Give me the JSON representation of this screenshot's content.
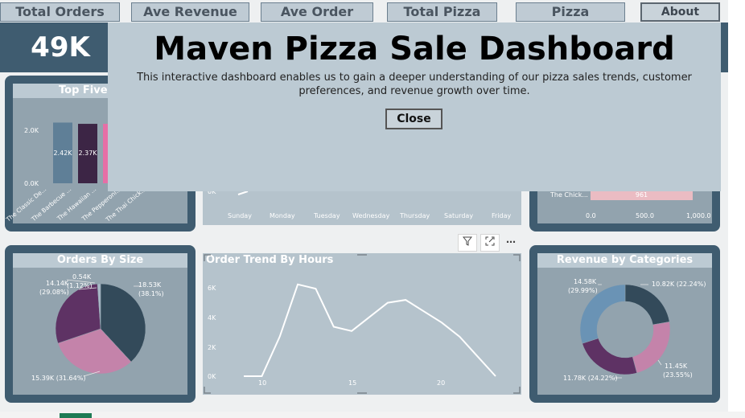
{
  "nav": {
    "total_orders": "Total Orders",
    "ave_revenue": "Ave Revenue",
    "ave_order_price": "Ave Order Price",
    "total_pizza_types": "Total Pizza Types",
    "pizza_categories": "Pizza Categories",
    "about": "About"
  },
  "kpi": {
    "total_orders_value": "49K"
  },
  "modal": {
    "title": "Maven Pizza Sale Dashboard",
    "description": "This interactive dashboard enables us to gain a deeper understanding of our pizza sales trends, customer preferences, and revenue growth over time.",
    "close_label": "Close"
  },
  "colors": {
    "header": "#3f5c70",
    "panel_fill": "#92a3ae",
    "title_bar": "#bccad3",
    "modal": "#bccad3"
  },
  "icons": {
    "filter": "filter-icon",
    "focus": "focus-mode-icon",
    "more": "more-options-icon"
  },
  "top5": {
    "title": "Top Five Pizza",
    "y_ticks": [
      "2.0K",
      "0.0K"
    ],
    "categories": [
      "The Classic De...",
      "The Barbecue ...",
      "The Hawaiian ...",
      "The Pepperoni...",
      "The Thai Chick..."
    ],
    "bar_labels": [
      "2.42K",
      "2.37K",
      "2"
    ]
  },
  "weekday": {
    "y_tick": "0K",
    "days": [
      "Sunday",
      "Monday",
      "Tuesday",
      "Wednesday",
      "Thursday",
      "Saturday",
      "Friday"
    ]
  },
  "rightbar": {
    "category": "The Chick...",
    "value_label": "961",
    "x_ticks": [
      "0.0",
      "500.0",
      "1,000.0"
    ]
  },
  "size_panel": {
    "title": "Orders By Size",
    "labels": [
      "0.54K",
      "(1.12%)",
      "14.14K",
      "(29.08%)",
      "18.53K",
      "(38.1%)",
      "15.39K (31.64%)"
    ]
  },
  "hours_panel": {
    "title": "Order Trend By Hours",
    "y_ticks": [
      "6K",
      "4K",
      "2K",
      "0K"
    ],
    "x_ticks": [
      "10",
      "15",
      "20"
    ]
  },
  "cat_panel": {
    "title": "Revenue by Categories",
    "labels": [
      "14.58K",
      "(29.99%)",
      "10.82K (22.24%)",
      "11.45K",
      "(23.55%)",
      "11.78K (24.22%)"
    ]
  },
  "chart_data": [
    {
      "type": "bar",
      "title": "Top Five Pizza",
      "categories": [
        "The Classic De...",
        "The Barbecue ...",
        "The Hawaiian ...",
        "The Pepperoni...",
        "The Thai Chick..."
      ],
      "values": [
        2420,
        2370,
        2370
      ],
      "ylim": [
        0,
        2500
      ]
    },
    {
      "type": "pie",
      "title": "Orders By Size",
      "categories": [
        "18.53K",
        "15.39K",
        "14.14K",
        "0.54K"
      ],
      "values": [
        38.1,
        31.64,
        29.08,
        1.12
      ],
      "colors": [
        "#334a5a",
        "#c483aa",
        "#5e3264",
        "#a7b8c6"
      ]
    },
    {
      "type": "line",
      "title": "Order Trend By Hours",
      "x": [
        9,
        10,
        11,
        12,
        13,
        14,
        15,
        16,
        17,
        18,
        19,
        20,
        21,
        22,
        23
      ],
      "y": [
        0,
        0,
        2800,
        6500,
        6200,
        3500,
        3200,
        4200,
        5200,
        5400,
        4600,
        3800,
        2800,
        1400,
        0
      ],
      "xlim": [
        9,
        23
      ],
      "ylim": [
        0,
        7000
      ]
    },
    {
      "type": "pie",
      "title": "Revenue by Categories",
      "categories": [
        "10.82K",
        "11.45K",
        "11.78K",
        "14.58K"
      ],
      "values": [
        22.24,
        23.55,
        24.22,
        29.99
      ],
      "colors": [
        "#334a5a",
        "#c483aa",
        "#5e3264",
        "#6a93b5"
      ]
    }
  ]
}
